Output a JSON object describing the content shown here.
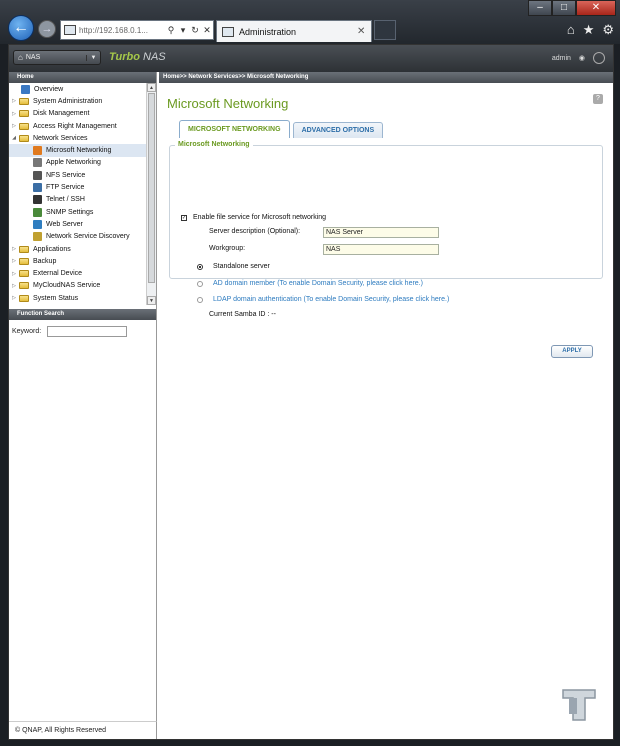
{
  "browser": {
    "url": "http://192.168.0.1...",
    "tab_title": "Administration",
    "tab_close": "✕"
  },
  "app": {
    "device": "NAS",
    "brand_turbo": "Turbo",
    "brand_nas": " NAS",
    "user": "admin"
  },
  "sidebar": {
    "home": "Home",
    "items": [
      {
        "label": "Overview",
        "type": "leaf",
        "icon": "overview-icon"
      },
      {
        "label": "System Administration",
        "type": "folder"
      },
      {
        "label": "Disk Management",
        "type": "folder"
      },
      {
        "label": "Access Right Management",
        "type": "folder"
      },
      {
        "label": "Network Services",
        "type": "folder-open"
      },
      {
        "label": "Microsoft Networking",
        "type": "child",
        "icon": "windows-icon",
        "selected": true
      },
      {
        "label": "Apple Networking",
        "type": "child",
        "icon": "apple-icon"
      },
      {
        "label": "NFS Service",
        "type": "child",
        "icon": "nfs-icon"
      },
      {
        "label": "FTP Service",
        "type": "child",
        "icon": "ftp-icon"
      },
      {
        "label": "Telnet / SSH",
        "type": "child",
        "icon": "terminal-icon"
      },
      {
        "label": "SNMP Settings",
        "type": "child",
        "icon": "snmp-icon"
      },
      {
        "label": "Web Server",
        "type": "child",
        "icon": "globe-icon"
      },
      {
        "label": "Network Service Discovery",
        "type": "child",
        "icon": "discovery-icon"
      },
      {
        "label": "Applications",
        "type": "folder"
      },
      {
        "label": "Backup",
        "type": "folder"
      },
      {
        "label": "External Device",
        "type": "folder"
      },
      {
        "label": "MyCloudNAS Service",
        "type": "folder"
      },
      {
        "label": "System Status",
        "type": "folder"
      }
    ],
    "function_search": "Function Search",
    "keyword_label": "Keyword:"
  },
  "main": {
    "breadcrumb": "Home>> Network Services>> Microsoft Networking",
    "title": "Microsoft Networking",
    "tabs": [
      "MICROSOFT NETWORKING",
      "ADVANCED OPTIONS"
    ],
    "section_title": "Microsoft Networking",
    "enable_label": "Enable file service for Microsoft networking",
    "server_desc_label": "Server description (Optional):",
    "server_desc_value": "NAS Server",
    "workgroup_label": "Workgroup:",
    "workgroup_value": "NAS",
    "standalone_label": "Standalone server",
    "ad_label": "AD domain member (To enable Domain Security, please click here.)",
    "ldap_label": "LDAP domain authentication (To enable Domain Security, please click here.)",
    "samba_label": "Current Samba ID : --",
    "apply": "APPLY"
  },
  "footer": {
    "copyright": "© QNAP, All Rights Reserved"
  }
}
